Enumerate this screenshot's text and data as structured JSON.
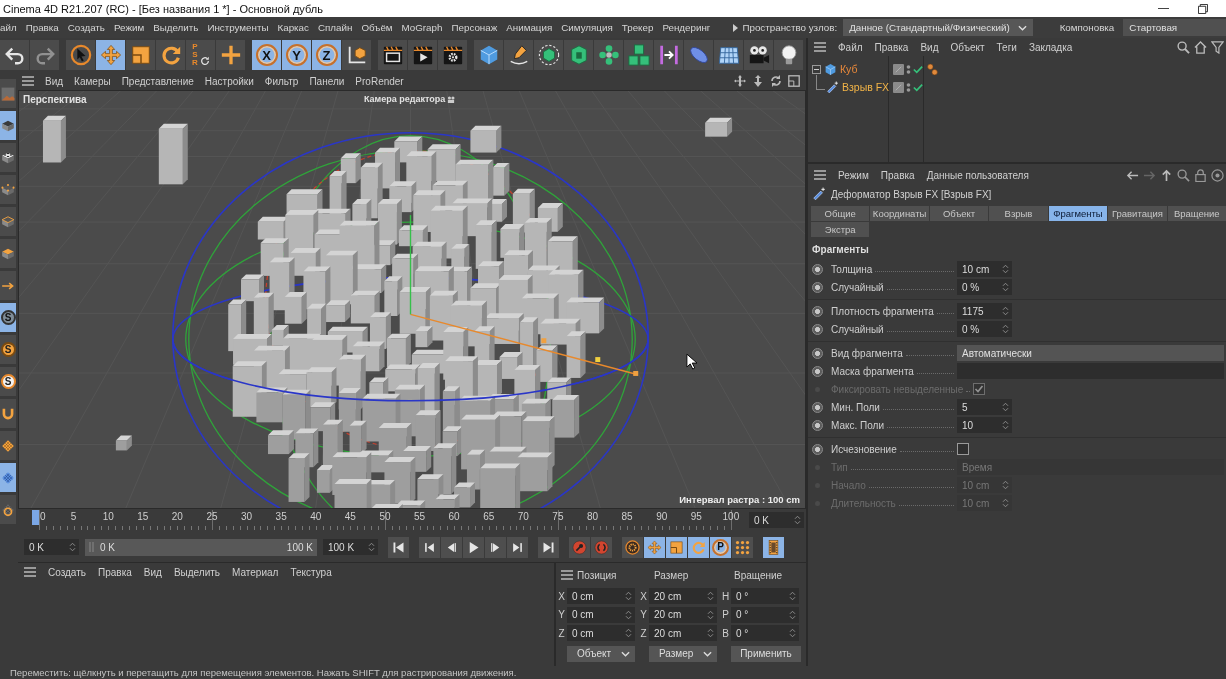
{
  "window": {
    "title": "Cinema 4D R21.207 (RC) - [Без названия 1 *] - Основной дубль"
  },
  "menu_bar": {
    "items": [
      "айл",
      "Правка",
      "Создать",
      "Режим",
      "Выделить",
      "Инструменты",
      "Каркас",
      "Сплайн",
      "Объём",
      "MoGraph",
      "Персонаж",
      "Анимация",
      "Симуляция",
      "Трекер",
      "Рендеринг"
    ],
    "node_space": {
      "label": "Пространство узлов:",
      "value": "Данное (Стандартный/Физический)"
    },
    "layout": {
      "label": "Компоновка",
      "value": "Стартовая"
    }
  },
  "toolbar": [
    {
      "tools": [
        {
          "kind": "undo",
          "selected": false,
          "disabled": false
        },
        {
          "kind": "redo",
          "selected": false,
          "disabled": true
        }
      ]
    },
    {
      "tools": [
        {
          "kind": "select",
          "selected": false,
          "disabled": false
        },
        {
          "kind": "move",
          "selected": true,
          "disabled": false
        },
        {
          "kind": "scale",
          "selected": false,
          "disabled": false
        },
        {
          "kind": "rotate",
          "selected": false,
          "disabled": false
        },
        {
          "kind": "psr",
          "label": "PSR",
          "selected": false,
          "disabled": false
        },
        {
          "kind": "add",
          "selected": false,
          "disabled": false
        }
      ]
    },
    {
      "tools": [
        {
          "kind": "axis",
          "label": "X",
          "selected": true,
          "disabled": false
        },
        {
          "kind": "axis",
          "label": "Y",
          "selected": true,
          "disabled": false
        },
        {
          "kind": "axis",
          "label": "Z",
          "selected": true,
          "disabled": false
        },
        {
          "kind": "coords",
          "selected": false,
          "disabled": false
        }
      ]
    },
    {
      "tools": [
        {
          "kind": "renderview",
          "selected": false,
          "disabled": false
        },
        {
          "kind": "renderviewer",
          "selected": false,
          "disabled": false
        },
        {
          "kind": "rendersettings",
          "selected": false,
          "disabled": false
        }
      ]
    },
    {
      "tools": [
        {
          "kind": "cube",
          "selected": false,
          "disabled": false
        },
        {
          "kind": "pen",
          "selected": false,
          "disabled": false
        },
        {
          "kind": "subdivision",
          "selected": false,
          "disabled": false
        },
        {
          "kind": "extrude",
          "selected": false,
          "disabled": false
        },
        {
          "kind": "cloner",
          "selected": false,
          "disabled": false
        },
        {
          "kind": "array",
          "selected": false,
          "disabled": false
        },
        {
          "kind": "deformer",
          "selected": false,
          "disabled": false
        },
        {
          "kind": "disc",
          "selected": false,
          "disabled": false
        },
        {
          "kind": "floor",
          "selected": false,
          "disabled": false
        },
        {
          "kind": "camera",
          "selected": false,
          "disabled": false
        },
        {
          "kind": "light",
          "selected": false,
          "disabled": false
        }
      ]
    }
  ],
  "left_toolbar": [
    {
      "kind": "thumbnail",
      "selected": false
    },
    {
      "kind": "model",
      "selected": true
    },
    {
      "kind": "texture",
      "selected": false
    },
    {
      "kind": "points",
      "selected": false
    },
    {
      "kind": "edges",
      "selected": false
    },
    {
      "kind": "polygons",
      "selected": false
    },
    {
      "kind": "axismode",
      "selected": false
    },
    {
      "kind": "snap",
      "label": "S",
      "selected": true
    },
    {
      "kind": "quantize",
      "label": "S",
      "selected": false
    },
    {
      "kind": "snapsettings",
      "label": "S",
      "selected": false
    },
    {
      "kind": "magnet",
      "selected": false
    },
    {
      "kind": "workplane",
      "selected": false
    },
    {
      "kind": "planar",
      "selected": true
    },
    {
      "kind": "lock",
      "selected": false
    }
  ],
  "viewport": {
    "menu": [
      "Вид",
      "Камеры",
      "Представление",
      "Настройки",
      "Фильтр",
      "Панели",
      "ProRender"
    ],
    "view_name": "Перспектива",
    "camera": "Камера редактора",
    "grid_spacing": "Интервал растра : 100 cm"
  },
  "timeline": {
    "ruler": [
      {
        "label": "0",
        "selected": true
      },
      {
        "label": "5",
        "selected": false
      },
      {
        "label": "10",
        "selected": false
      },
      {
        "label": "15",
        "selected": false
      },
      {
        "label": "20",
        "selected": false
      },
      {
        "label": "25",
        "selected": false
      },
      {
        "label": "30",
        "selected": false
      },
      {
        "label": "35",
        "selected": false
      },
      {
        "label": "40",
        "selected": false
      },
      {
        "label": "45",
        "selected": false
      },
      {
        "label": "50",
        "selected": false
      },
      {
        "label": "55",
        "selected": false
      },
      {
        "label": "60",
        "selected": false
      },
      {
        "label": "65",
        "selected": false
      },
      {
        "label": "70",
        "selected": false
      },
      {
        "label": "75",
        "selected": false
      },
      {
        "label": "80",
        "selected": false
      },
      {
        "label": "85",
        "selected": false
      },
      {
        "label": "90",
        "selected": false
      },
      {
        "label": "95",
        "selected": false
      },
      {
        "label": "100",
        "selected": false
      }
    ],
    "current_frame": "0 K",
    "start": "0 K",
    "range": {
      "start_label": "0 K",
      "end_label": "100 K",
      "level": 1
    },
    "end": "100 K",
    "controls": [
      {
        "buttons": [
          {
            "kind": "start",
            "selected": false
          }
        ]
      },
      {
        "buttons": [
          {
            "kind": "prevkey",
            "selected": false
          },
          {
            "kind": "prevframe",
            "selected": false
          },
          {
            "kind": "play",
            "selected": false
          },
          {
            "kind": "nextframe",
            "selected": false
          },
          {
            "kind": "nextkey",
            "selected": false
          }
        ]
      },
      {
        "buttons": [
          {
            "kind": "end",
            "selected": false
          }
        ]
      },
      {
        "buttons": [
          {
            "kind": "record",
            "selected": false
          },
          {
            "kind": "autokey",
            "selected": false
          }
        ]
      },
      {
        "buttons": [
          {
            "kind": "keyset",
            "selected": false
          },
          {
            "kind": "keymove",
            "selected": true
          },
          {
            "kind": "keyscale",
            "selected": true
          },
          {
            "kind": "keyrotate",
            "selected": true
          },
          {
            "kind": "keyparam",
            "label": "P",
            "selected": true
          },
          {
            "kind": "keypoints",
            "selected": false
          }
        ]
      },
      {
        "buttons": [
          {
            "kind": "film",
            "selected": true
          }
        ]
      }
    ]
  },
  "material_manager": {
    "menu": [
      "Создать",
      "Правка",
      "Вид",
      "Выделить",
      "Материал",
      "Текстура"
    ]
  },
  "coordinates": {
    "headers": [
      "Позиция",
      "Размер",
      "Вращение"
    ],
    "rows": [
      {
        "cells": [
          {
            "axis": "X",
            "value": "0 cm"
          },
          {
            "axis": "X",
            "value": "20 cm"
          },
          {
            "axis": "H",
            "value": "0 °"
          }
        ]
      },
      {
        "cells": [
          {
            "axis": "Y",
            "value": "0 cm"
          },
          {
            "axis": "Y",
            "value": "20 cm"
          },
          {
            "axis": "P",
            "value": "0 °"
          }
        ]
      },
      {
        "cells": [
          {
            "axis": "Z",
            "value": "0 cm"
          },
          {
            "axis": "Z",
            "value": "20 cm"
          },
          {
            "axis": "B",
            "value": "0 °"
          }
        ]
      }
    ],
    "modes": [
      "Объект",
      "Размер"
    ],
    "apply": "Применить"
  },
  "object_manager": {
    "menu": [
      "Файл",
      "Правка",
      "Вид",
      "Объект",
      "Теги",
      "Закладка"
    ],
    "objects": [
      {
        "name": "Куб",
        "kind": "cube",
        "color": "#e8883a",
        "expanded": true,
        "enabled": true,
        "tags": [
          {
            "kind": "phong"
          }
        ],
        "children": [
          {
            "name": "Взрыв FX",
            "kind": "deformer",
            "color": "#f2b447",
            "enabled": true
          }
        ]
      }
    ]
  },
  "attributes": {
    "menu": [
      "Режим",
      "Правка",
      "Данные пользователя"
    ],
    "object_title": "Деформатор Взрыв FX [Взрыв FX]",
    "tabs": [
      {
        "label": "Общие",
        "selected": false
      },
      {
        "label": "Координаты",
        "selected": false
      },
      {
        "label": "Объект",
        "selected": false
      },
      {
        "label": "Взрыв",
        "selected": false
      },
      {
        "label": "Фрагменты",
        "selected": true
      },
      {
        "label": "Гравитация",
        "selected": false
      },
      {
        "label": "Вращение",
        "selected": false
      },
      {
        "label": "Экстра",
        "selected": false
      }
    ],
    "section": "Фрагменты",
    "groups": [
      {
        "params": [
          {
            "label": "Толщина",
            "kind": "number",
            "value": "10 cm",
            "disabled": false
          },
          {
            "label": "Случайный",
            "kind": "number",
            "value": "0 %",
            "disabled": false
          }
        ]
      },
      {
        "params": [
          {
            "label": "Плотность фрагмента",
            "kind": "number",
            "value": "1175",
            "disabled": false
          },
          {
            "label": "Случайный",
            "kind": "number",
            "value": "0 %",
            "disabled": false
          }
        ]
      },
      {
        "params": [
          {
            "label": "Вид фрагмента",
            "kind": "dropdown",
            "value": "Автоматически",
            "disabled": false
          },
          {
            "label": "Маска фрагмента",
            "kind": "link",
            "disabled": false
          },
          {
            "label": "Фиксировать невыделенные",
            "kind": "checkbox",
            "checked": true,
            "disabled": true
          },
          {
            "label": "Мин. Поли",
            "kind": "number",
            "value": "5",
            "disabled": false
          },
          {
            "label": "Макс. Поли",
            "kind": "number",
            "value": "10",
            "disabled": false
          }
        ]
      },
      {
        "params": [
          {
            "label": "Исчезновение",
            "kind": "checkbox",
            "checked": false,
            "disabled": false
          },
          {
            "label": "Тип",
            "kind": "dropdown",
            "value": "Время",
            "disabled": true
          },
          {
            "label": "Начало",
            "kind": "number",
            "value": "10 cm",
            "disabled": true
          },
          {
            "label": "Длительность",
            "kind": "number",
            "value": "10 cm",
            "disabled": true
          }
        ]
      }
    ]
  },
  "status_bar": {
    "text": "Переместить: щёлкнуть и перетащить для перемещения элементов. Нажать SHIFT для растрирования движения."
  }
}
